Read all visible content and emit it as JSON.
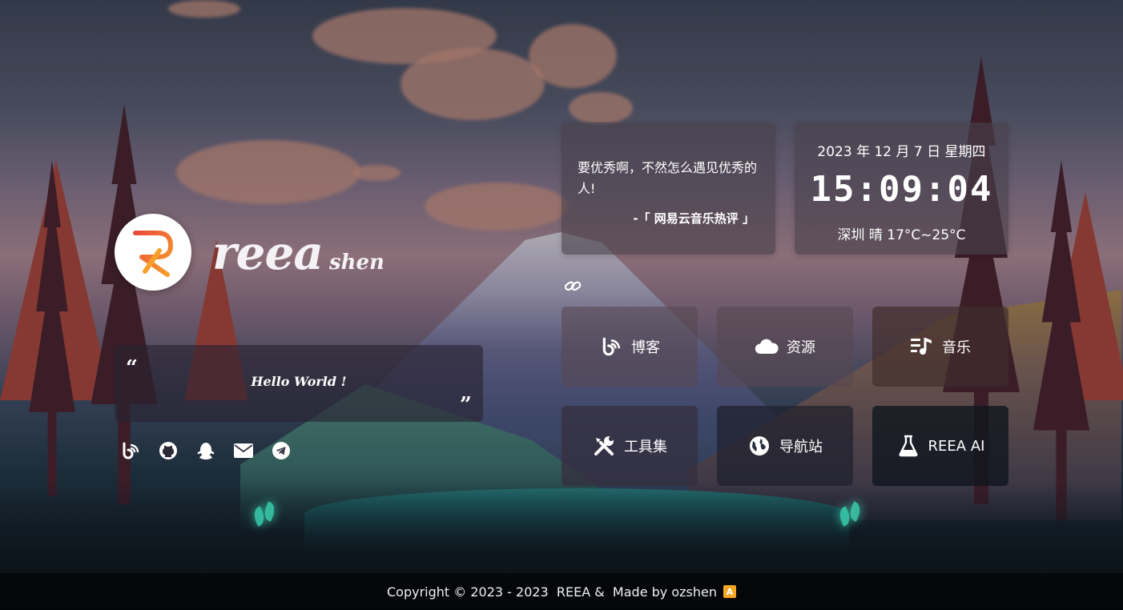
{
  "profile": {
    "brand_main": "reea",
    "brand_sub": "shen",
    "quote": "Hello World !"
  },
  "socials": [
    {
      "icon": "blog-icon"
    },
    {
      "icon": "github-icon"
    },
    {
      "icon": "qq-icon"
    },
    {
      "icon": "mail-icon"
    },
    {
      "icon": "telegram-icon"
    }
  ],
  "hitokoto": {
    "text": "要优秀啊，不然怎么遇见优秀的人!",
    "from": "-「 网易云音乐热评 」"
  },
  "clock": {
    "date": "2023 年 12 月 7 日 星期四",
    "time": "15:09:04",
    "weather": "深圳 晴 17°C~25°C"
  },
  "links": {
    "blog": "博客",
    "resources": "资源",
    "music": "音乐",
    "tools": "工具集",
    "navigation": "导航站",
    "ai": "REEA AI"
  },
  "footer": {
    "copyright": "Copyright © 2023 - 2023  REEA &  Made by ozshen",
    "badge": "A"
  },
  "colors": {
    "accent": "#f5a623",
    "logo_red": "#e94b3c",
    "logo_orange": "#f7a12b"
  }
}
